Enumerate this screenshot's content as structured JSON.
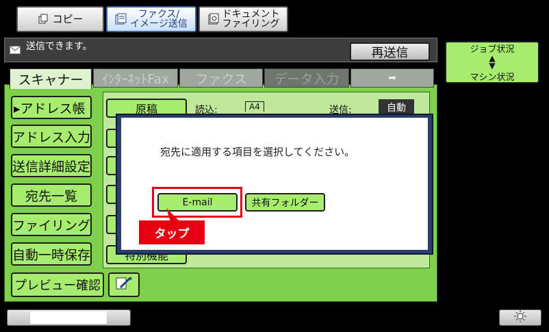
{
  "modes": [
    {
      "label": "コピー",
      "icon": "copy-icon"
    },
    {
      "label": "ファクス/\nイメージ送信",
      "icon": "fax-image-send-icon"
    },
    {
      "label": "ドキュメント\nファイリング",
      "icon": "document-filing-icon"
    }
  ],
  "status": {
    "message": "送信できます。",
    "resend_label": "再送信"
  },
  "tabs": [
    {
      "label": "スキャナー"
    },
    {
      "label": "ｲﾝﾀｰﾈｯﾄFax"
    },
    {
      "label": "ファクス"
    },
    {
      "label": "データ入力"
    },
    {
      "label": "➡"
    }
  ],
  "job": {
    "top": "ジョブ状況",
    "bottom": "マシン状況"
  },
  "left_buttons": [
    {
      "label": "▸アドレス帳"
    },
    {
      "label": "アドレス入力"
    },
    {
      "label": "送信詳細設定"
    },
    {
      "label": "宛先一覧"
    },
    {
      "label": "ファイリング"
    },
    {
      "label": "自動一時保存"
    },
    {
      "label": "プレビュー確認"
    }
  ],
  "content": {
    "original_label": "原稿",
    "read_label": "読込:",
    "paper": "A4",
    "send_label": "送信:",
    "auto_label": "自動",
    "special_label": "特別機能"
  },
  "dialog": {
    "message": "宛先に適用する項目を選択してください。",
    "email_label": "E-mail",
    "shared_folder_label": "共有フォルダー"
  },
  "callout": {
    "label": "タップ"
  }
}
